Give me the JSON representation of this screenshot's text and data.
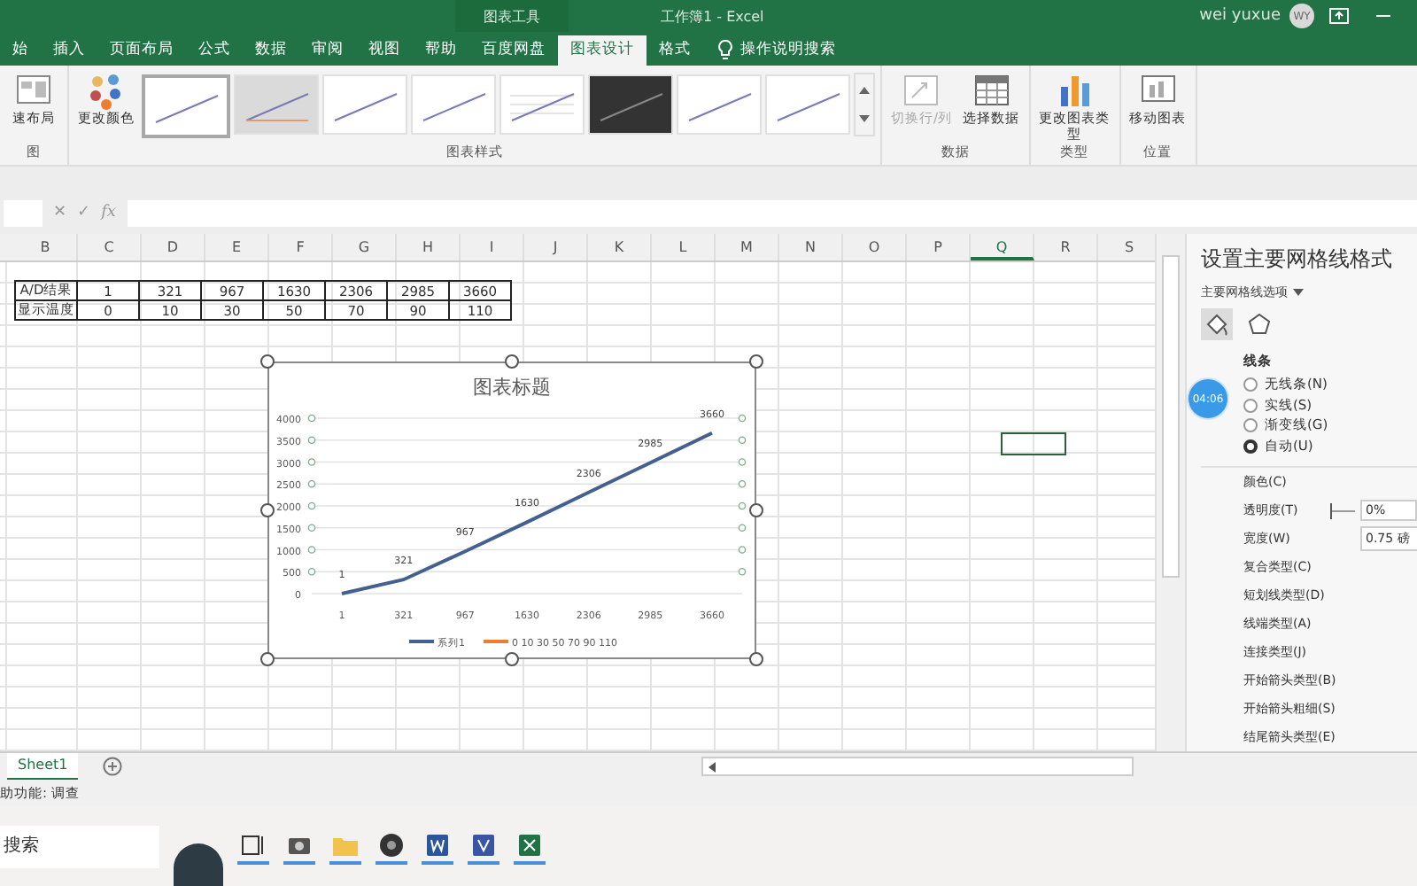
{
  "title_bar": {
    "context_tab": "图表工具",
    "title": "工作簿1 - Excel",
    "user": "wei yuxue",
    "avatar": "WY"
  },
  "ribbon_tabs": [
    {
      "label": "始",
      "selected": false
    },
    {
      "label": "插入",
      "selected": false
    },
    {
      "label": "页面布局",
      "selected": false
    },
    {
      "label": "公式",
      "selected": false
    },
    {
      "label": "数据",
      "selected": false
    },
    {
      "label": "审阅",
      "selected": false
    },
    {
      "label": "视图",
      "selected": false
    },
    {
      "label": "帮助",
      "selected": false
    },
    {
      "label": "百度网盘",
      "selected": false
    },
    {
      "label": "图表设计",
      "selected": true
    },
    {
      "label": "格式",
      "selected": false
    }
  ],
  "tell_me": "操作说明搜索",
  "ribbon_groups": [
    {
      "kind": "buttons",
      "label": "图",
      "buttons": [
        {
          "label": "速布局",
          "disabled": false
        }
      ]
    },
    {
      "kind": "styles",
      "label": "图表样式",
      "buttons": [
        {
          "label": "更改颜色",
          "disabled": false
        }
      ],
      "styles": [
        {
          "kind": "plain",
          "selected": true
        },
        {
          "kind": "shaded",
          "selected": false
        },
        {
          "kind": "plain",
          "selected": false
        },
        {
          "kind": "plain",
          "selected": false
        },
        {
          "kind": "gridded",
          "selected": false
        },
        {
          "kind": "dark",
          "selected": false
        },
        {
          "kind": "plain",
          "selected": false
        },
        {
          "kind": "plain",
          "selected": false
        }
      ]
    },
    {
      "kind": "buttons",
      "label": "数据",
      "buttons": [
        {
          "label": "切换行/列",
          "disabled": true
        },
        {
          "label": "选择数据",
          "disabled": false
        }
      ]
    },
    {
      "kind": "buttons",
      "label": "类型",
      "buttons": [
        {
          "label": "更改图表类型",
          "disabled": false
        }
      ]
    },
    {
      "kind": "buttons",
      "label": "位置",
      "buttons": [
        {
          "label": "移动图表",
          "disabled": false
        }
      ]
    }
  ],
  "formula_bar": {
    "cancel": "✕",
    "enter": "✓",
    "function": "fx"
  },
  "columns": [
    {
      "label": "B",
      "selected": false
    },
    {
      "label": "C",
      "selected": false
    },
    {
      "label": "D",
      "selected": false
    },
    {
      "label": "E",
      "selected": false
    },
    {
      "label": "F",
      "selected": false
    },
    {
      "label": "G",
      "selected": false
    },
    {
      "label": "H",
      "selected": false
    },
    {
      "label": "I",
      "selected": false
    },
    {
      "label": "J",
      "selected": false
    },
    {
      "label": "K",
      "selected": false
    },
    {
      "label": "L",
      "selected": false
    },
    {
      "label": "M",
      "selected": false
    },
    {
      "label": "N",
      "selected": false
    },
    {
      "label": "O",
      "selected": false
    },
    {
      "label": "P",
      "selected": false
    },
    {
      "label": "Q",
      "selected": true
    },
    {
      "label": "R",
      "selected": false
    },
    {
      "label": "S",
      "selected": false
    }
  ],
  "table_rows": [
    [
      "A/D结果",
      "1",
      "321",
      "967",
      "1630",
      "2306",
      "2985",
      "3660"
    ],
    [
      "显示温度",
      "0",
      "10",
      "30",
      "50",
      "70",
      "90",
      "110"
    ]
  ],
  "chart": {
    "chart_data": {
      "type": "line",
      "title": "图表标题",
      "categories": [
        "1",
        "321",
        "967",
        "1630",
        "2306",
        "2985",
        "3660"
      ],
      "series": [
        {
          "name": "系列1",
          "color": "#44608f",
          "values": [
            1,
            321,
            967,
            1630,
            2306,
            2985,
            3660
          ]
        },
        {
          "name": "0 10 30 50 70 90 110",
          "color": "#ed7d31",
          "values": [
            null,
            null,
            null,
            null,
            null,
            null,
            null
          ]
        }
      ],
      "ylim": [
        0,
        4000
      ],
      "yticks": [
        0,
        500,
        1000,
        1500,
        2000,
        2500,
        3000,
        3500,
        4000
      ],
      "data_labels": true,
      "grid": true
    }
  },
  "panel": {
    "title": "设置主要网格线格式",
    "options_dropdown": "主要网格线选项",
    "tabs": [
      {
        "selected": true
      },
      {
        "selected": false
      }
    ],
    "section": "线条",
    "radios": [
      {
        "label": "无线条(N)",
        "selected": false
      },
      {
        "label": "实线(S)",
        "selected": false
      },
      {
        "label": "渐变线(G)",
        "selected": false
      },
      {
        "label": "自动(U)",
        "selected": true
      }
    ],
    "properties": [
      {
        "kind": "label",
        "label": "颜色(C)"
      },
      {
        "kind": "slider",
        "label": "透明度(T)",
        "level": 0,
        "value": "0%"
      },
      {
        "kind": "field",
        "label": "宽度(W)",
        "value": "0.75 磅"
      },
      {
        "kind": "label",
        "label": "复合类型(C)"
      },
      {
        "kind": "label",
        "label": "短划线类型(D)"
      },
      {
        "kind": "label",
        "label": "线端类型(A)"
      },
      {
        "kind": "label",
        "label": "连接类型(J)"
      },
      {
        "kind": "label",
        "label": "开始箭头类型(B)"
      },
      {
        "kind": "label",
        "label": "开始箭头粗细(S)"
      },
      {
        "kind": "label",
        "label": "结尾箭头类型(E)"
      }
    ]
  },
  "timer_badge": "04:06",
  "sheet_tabs": [
    {
      "label": "Sheet1",
      "selected": true
    }
  ],
  "status_bar": "助功能: 调查",
  "taskbar": {
    "search": "搜索"
  }
}
